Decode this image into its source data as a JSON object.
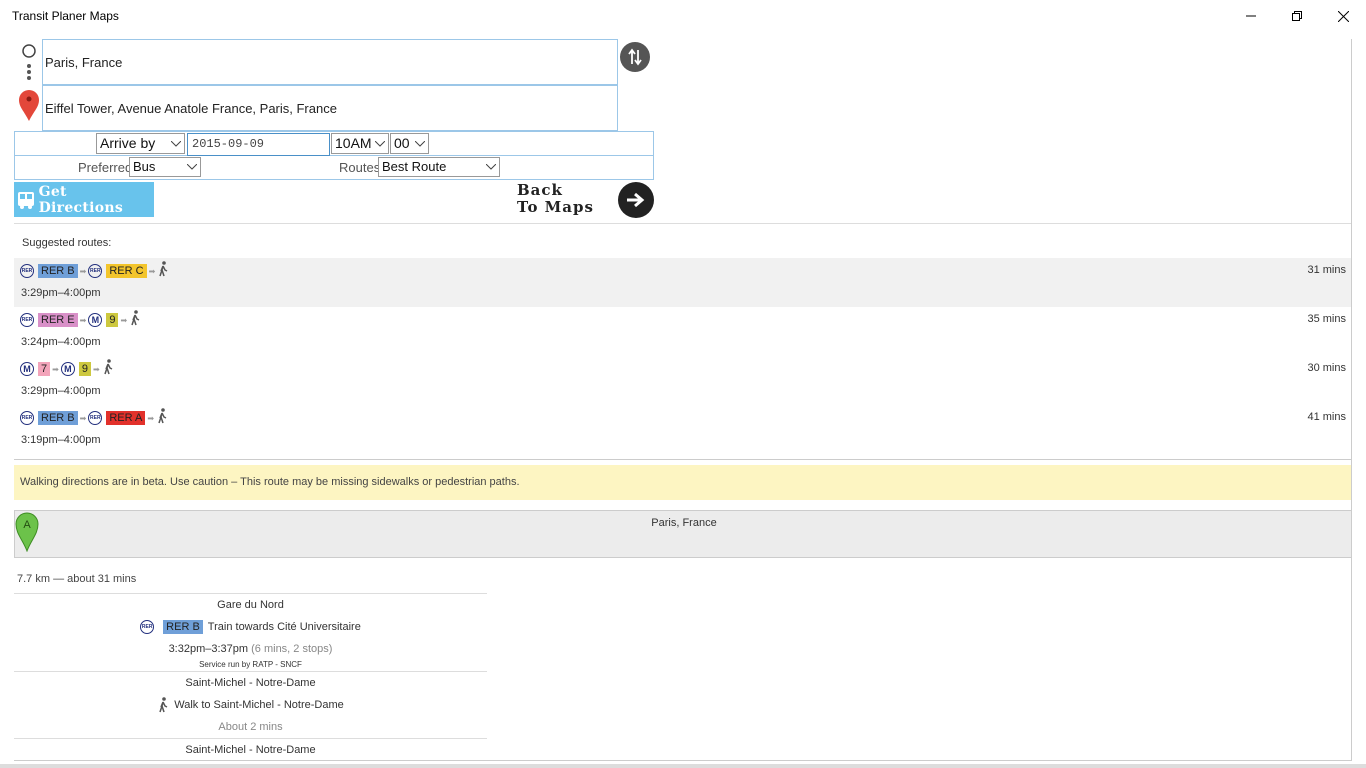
{
  "window": {
    "title": "Transit Planer Maps"
  },
  "form": {
    "origin": "Paris, France",
    "destination": "Eiffel Tower, Avenue Anatole France, Paris, France",
    "time_mode": "Arrive by",
    "date": "2015-09-09",
    "hour": "10AM",
    "minute": "00",
    "preferred_label": "Preferred",
    "preferred_value": "Bus",
    "routes_label": "Routes",
    "routes_value": "Best Route",
    "get_directions": "Get Directions",
    "back_line1": "Back",
    "back_line2": "To Maps"
  },
  "suggested_header": "Suggested routes:",
  "routes": [
    {
      "time": "3:29pm–4:00pm",
      "duration": "31 mins",
      "legs": [
        {
          "kind": "rer",
          "label": "RER B",
          "color": "#6f9fd8"
        },
        {
          "kind": "rer",
          "label": "RER C",
          "color": "#f3c52c"
        }
      ]
    },
    {
      "time": "3:24pm–4:00pm",
      "duration": "35 mins",
      "legs": [
        {
          "kind": "rer",
          "label": "RER E",
          "color": "#d990c8"
        },
        {
          "kind": "metro",
          "label": "9",
          "color": "#cdc83f"
        }
      ]
    },
    {
      "time": "3:29pm–4:00pm",
      "duration": "30 mins",
      "legs": [
        {
          "kind": "metro",
          "label": "7",
          "color": "#f3a4ba"
        },
        {
          "kind": "metro",
          "label": "9",
          "color": "#cdc83f"
        }
      ]
    },
    {
      "time": "3:19pm–4:00pm",
      "duration": "41 mins",
      "legs": [
        {
          "kind": "rer",
          "label": "RER B",
          "color": "#6f9fd8"
        },
        {
          "kind": "rer",
          "label": "RER A",
          "color": "#e2312b"
        }
      ]
    }
  ],
  "warning": "Walking directions are in beta. Use caution – This route may be missing sidewalks or pedestrian paths.",
  "start": {
    "marker": "A",
    "address": "Paris, France"
  },
  "summary": "7.7 km — about 31 mins",
  "steps": {
    "s1_name": "Gare du Nord",
    "s1_line": "RER B",
    "s1_desc": "Train towards Cité Universitaire",
    "s1_time": "3:32pm–3:37pm",
    "s1_detail": "(6 mins, 2 stops)",
    "s1_service": "Service run by RATP - SNCF",
    "s2_name": "Saint-Michel - Notre-Dame",
    "s2_desc": "Walk to Saint-Michel - Notre-Dame",
    "s2_time": "About 2 mins",
    "s3_name": "Saint-Michel - Notre-Dame"
  },
  "icons": {
    "rer_logo": "RER",
    "metro_logo": "M"
  }
}
